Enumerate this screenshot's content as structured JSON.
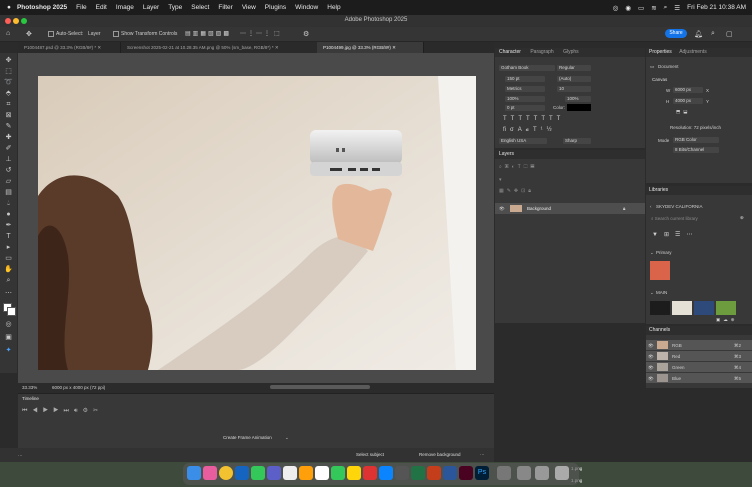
{
  "menubar": {
    "app": "Photoshop 2025",
    "items": [
      "File",
      "Edit",
      "Image",
      "Layer",
      "Type",
      "Select",
      "Filter",
      "View",
      "Plugins",
      "Window",
      "Help"
    ],
    "datetime": "Fri Feb 21  10:38 AM"
  },
  "titlebar": {
    "title": "Adobe Photoshop 2025",
    "share": "Share"
  },
  "options": {
    "auto_select": "Auto-Select:",
    "target": "Layer",
    "transform": "Show Transform Controls"
  },
  "tabs": [
    "P1004487.psd @ 33.3% (RGB/8#) *",
    "Screenshot 2025-02-21 at 10.28.35 AM.png @ 50% (sm_base, RGB/8*) *",
    "P1004499.jpg @ 33.3% (RGB/8#)"
  ],
  "status": {
    "zoom": "33.33%",
    "size": "6000 px x 4000 px (72 ppi)"
  },
  "timeline": {
    "title": "Timeline",
    "create": "Create Frame Animation"
  },
  "taskbar": {
    "select_subject": "Select subject",
    "remove_bg": "Remove background"
  },
  "character": {
    "tabs": [
      "Character",
      "Paragraph",
      "Glyphs"
    ],
    "font": "Gotham Book",
    "style": "Regular",
    "size": "150 pt",
    "leading": "(Auto)",
    "kerning": "Metrics",
    "tracking": "10",
    "vscale": "100%",
    "hscale": "100%",
    "baseline": "0 pt",
    "color_label": "Color:",
    "lang": "English USA",
    "aa": "Sharp"
  },
  "layers": {
    "title": "Layers",
    "layer": "Background"
  },
  "properties": {
    "tabs": [
      "Properties",
      "Adjustments"
    ],
    "doc": "Document",
    "canvas": "Canvas",
    "w": "6000 px",
    "h": "4000 px",
    "x": "X",
    "y": "Y",
    "resolution": "Resolution: 72 pixels/inch",
    "mode_label": "Mode",
    "mode": "RGB Color",
    "depth": "8 Bits/Channel"
  },
  "libraries": {
    "title": "Libraries",
    "name": "SKYDEV CALIFORNIA",
    "search": "Search current library",
    "primary": "Primary",
    "main": "MAIN",
    "colors": [
      "#d9644a",
      "#1c1c1c",
      "#e6e1d6",
      "#2d4a7a",
      "#6d9c3f"
    ]
  },
  "channels": {
    "title": "Channels",
    "rows": [
      {
        "name": "RGB",
        "key": "⌘2"
      },
      {
        "name": "Red",
        "key": "⌘3"
      },
      {
        "name": "Green",
        "key": "⌘4"
      },
      {
        "name": "Blue",
        "key": "⌘5"
      }
    ]
  },
  "desktop": {
    "file1": "1.png",
    "file2": "1.png"
  }
}
